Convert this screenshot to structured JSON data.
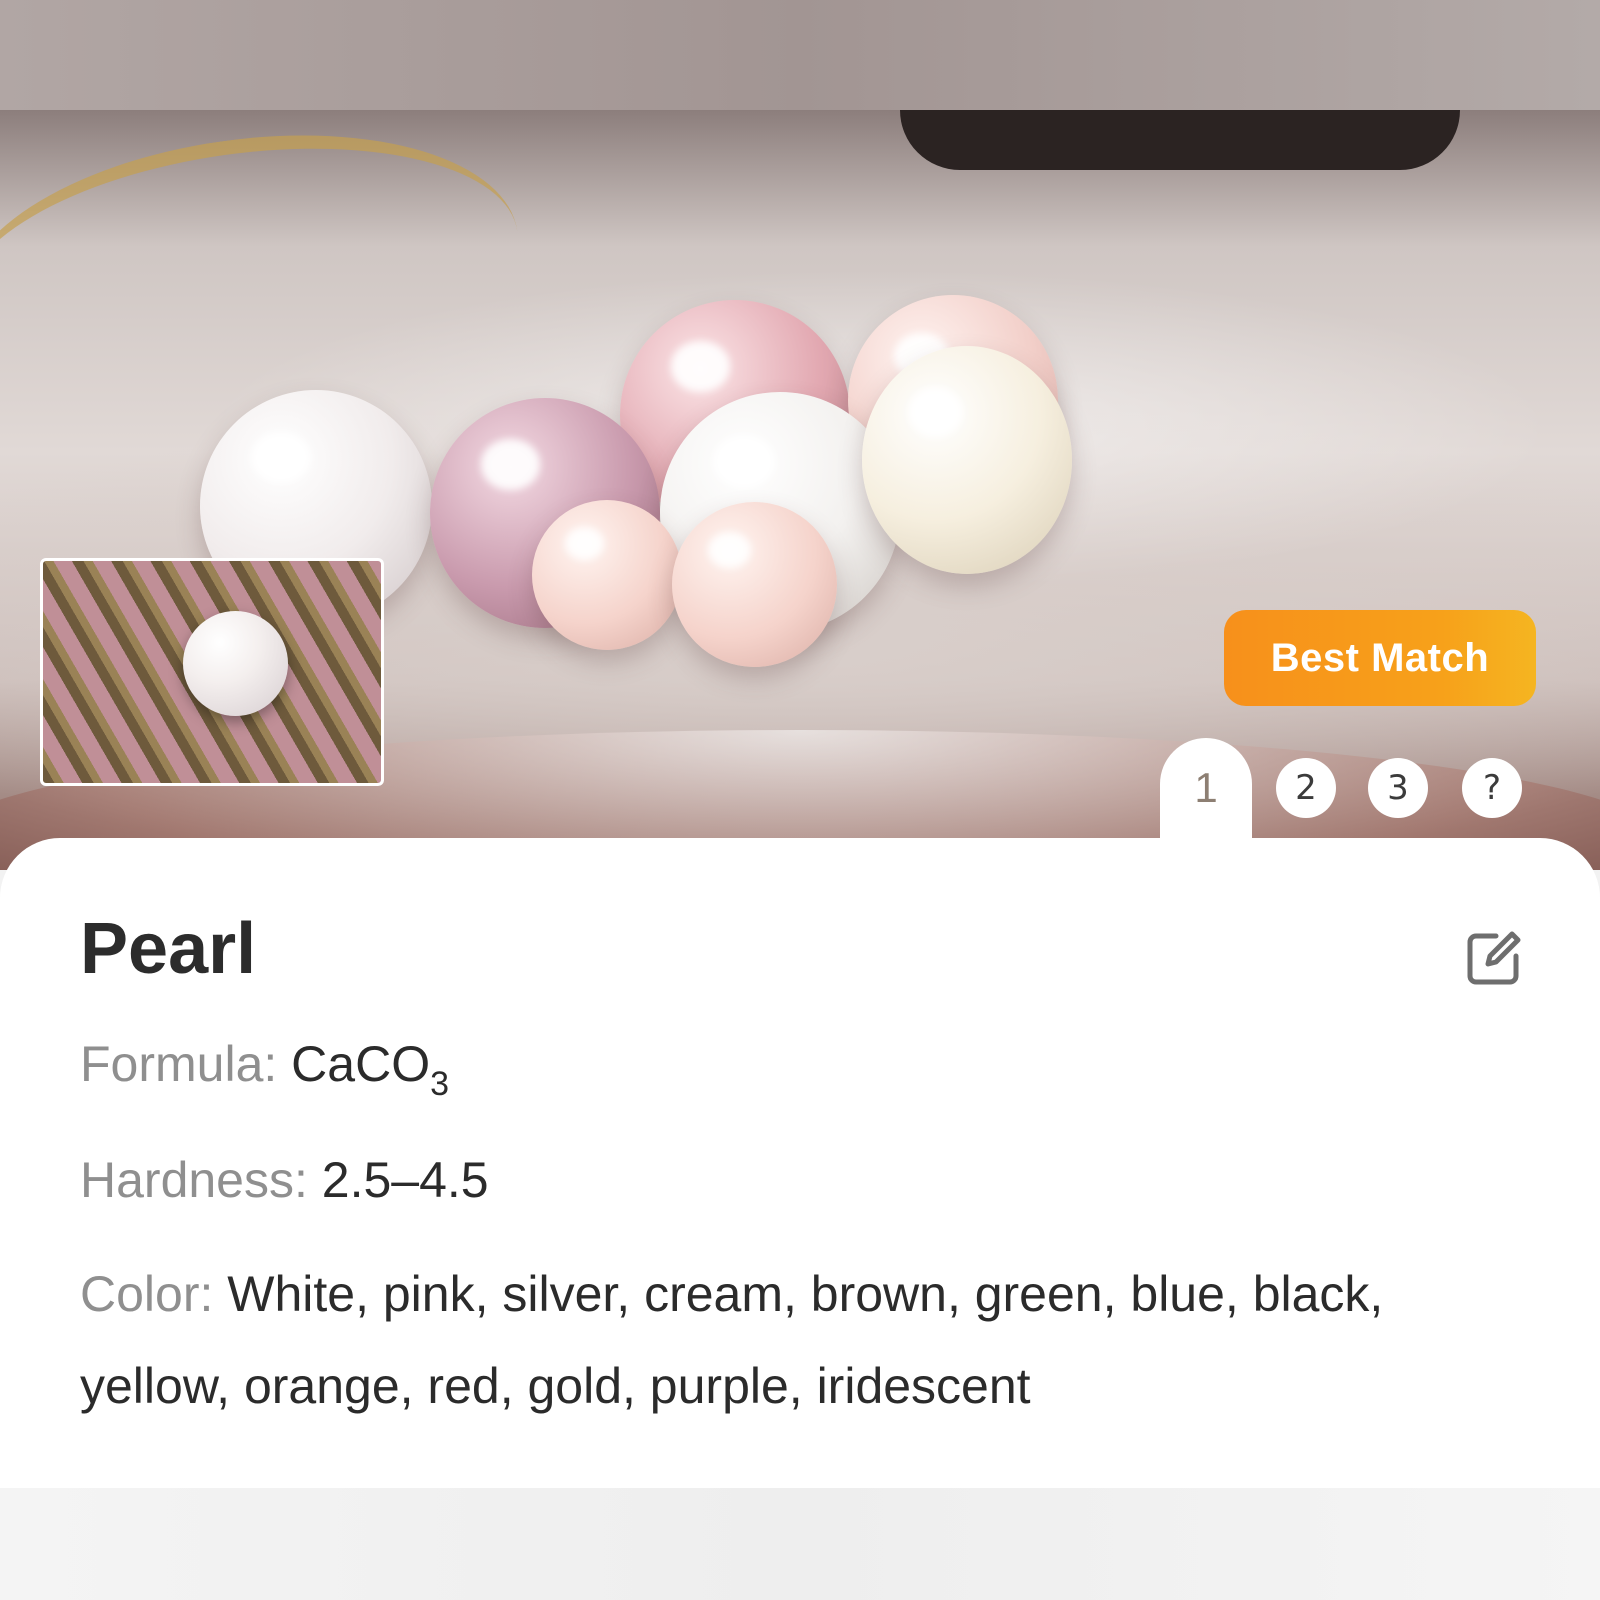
{
  "result": {
    "best_match_label": "Best Match",
    "tabs": [
      {
        "label": "1",
        "active": true
      },
      {
        "label": "2",
        "active": false
      },
      {
        "label": "3",
        "active": false
      },
      {
        "label": "?",
        "active": false
      }
    ]
  },
  "mineral": {
    "name": "Pearl",
    "formula_label": "Formula:",
    "formula_main": "CaCO",
    "formula_sub": "3",
    "hardness_label": "Hardness:",
    "hardness_value": "2.5–4.5",
    "color_label": "Color:",
    "color_value": "White, pink, silver, cream, brown, green, blue, black, yellow, orange, red, gold, purple, iridescent"
  },
  "icons": {
    "edit": "edit-icon"
  },
  "colors": {
    "accent": "#F7941D",
    "label_gray": "#8F8F8F",
    "text_dark": "#2B2B2B"
  }
}
